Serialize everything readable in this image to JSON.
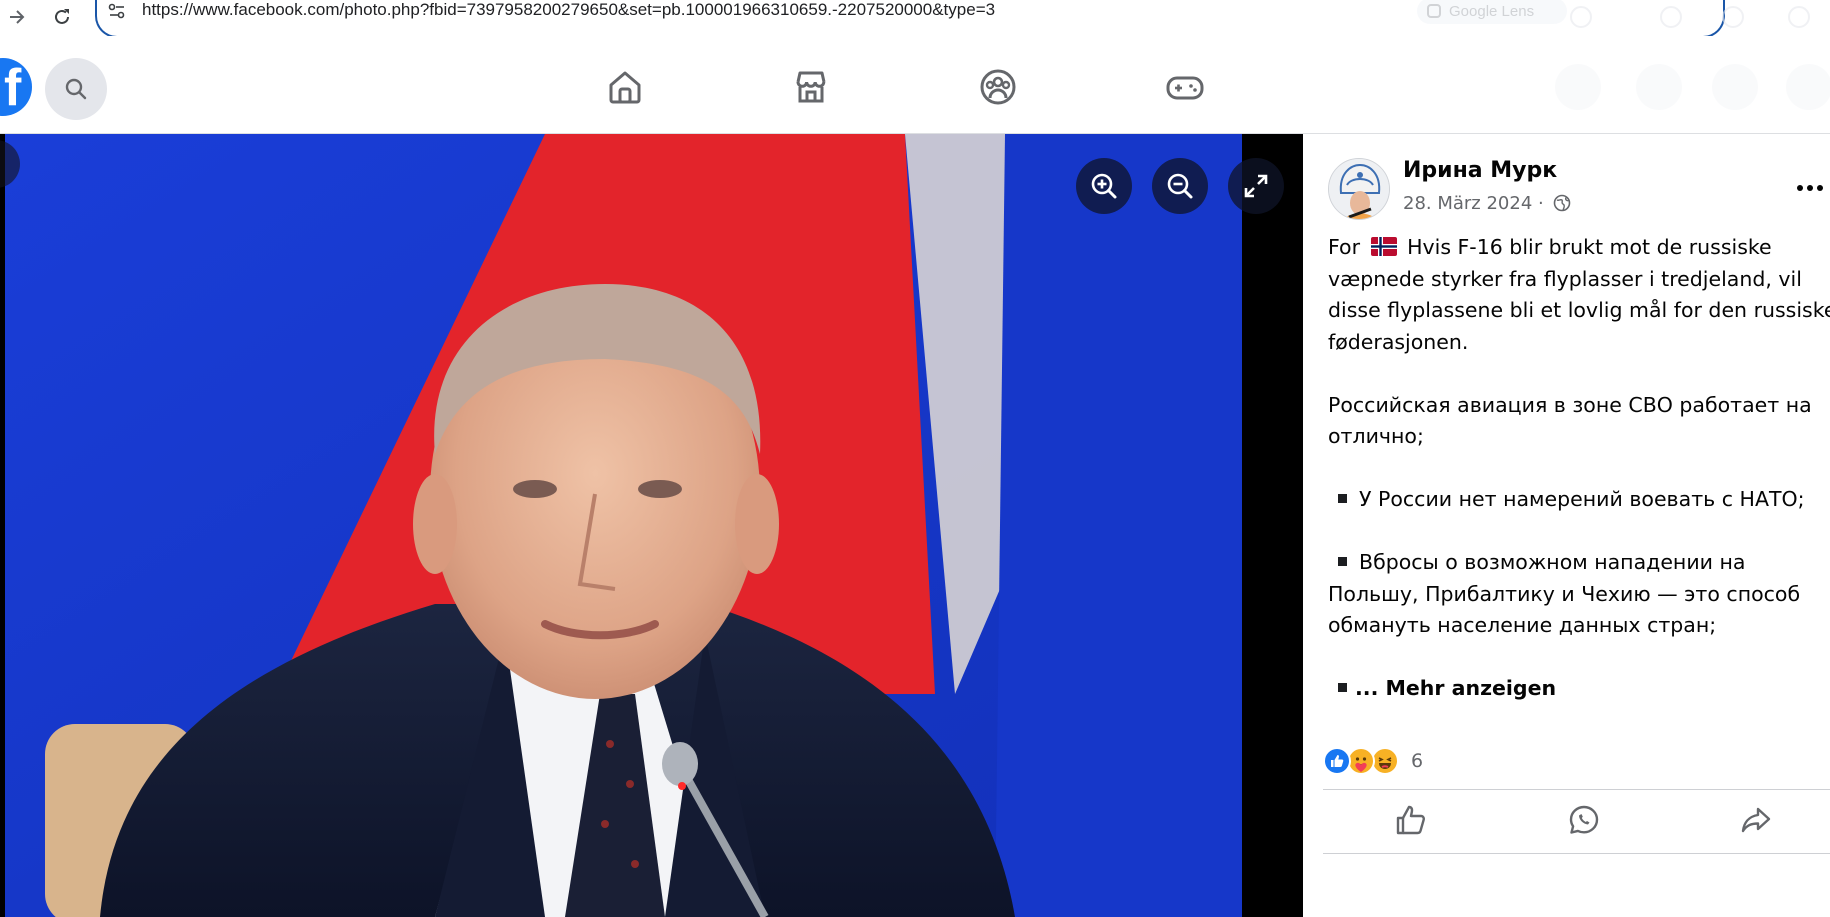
{
  "browser": {
    "url": "https://www.facebook.com/photo.php?fbid=7397958200279650&set=pb.100001966310659.-2207520000&type=3",
    "lens_label": "Google Lens"
  },
  "header": {
    "logo_letter": "f",
    "icons": [
      "search-icon",
      "home-icon",
      "marketplace-icon",
      "groups-icon",
      "gaming-icon"
    ]
  },
  "photo": {
    "controls": [
      "zoom-in-icon",
      "zoom-out-icon",
      "fullscreen-icon"
    ]
  },
  "post": {
    "author": "Ирина Мурк",
    "date": "28. März 2024 · ",
    "para1_lines": [
      [
        "For ",
        " Hvis F-16 blir brukt mot de russiske"
      ],
      "væpnede styrker fra flyplasser i tredjeland, vil",
      "disse flyplassene bli et lovlig mål for den russiske",
      "føderasjonen."
    ],
    "para2_lines": [
      "Российская авиация в зоне СВО работает на",
      "отлично;"
    ],
    "para3_line": "У России нет намерений воевать с НАТО;",
    "para4_lines": [
      "Вбросы о возможном нападении на",
      "Польшу, Прибалтику и Чехию — это способ",
      "обмануть население данных стран;"
    ],
    "more_link": "... Mehr anzeigen",
    "reaction_count": "6",
    "reactions": [
      "like-reaction-icon",
      "care-reaction-icon",
      "haha-reaction-icon"
    ],
    "actions": [
      "like-icon",
      "comment-icon",
      "share-icon"
    ]
  },
  "colors": {
    "facebook_blue": "#1877f2",
    "omnibox_border": "#1a56a8",
    "text_primary": "#050505",
    "text_secondary": "#65676b"
  }
}
